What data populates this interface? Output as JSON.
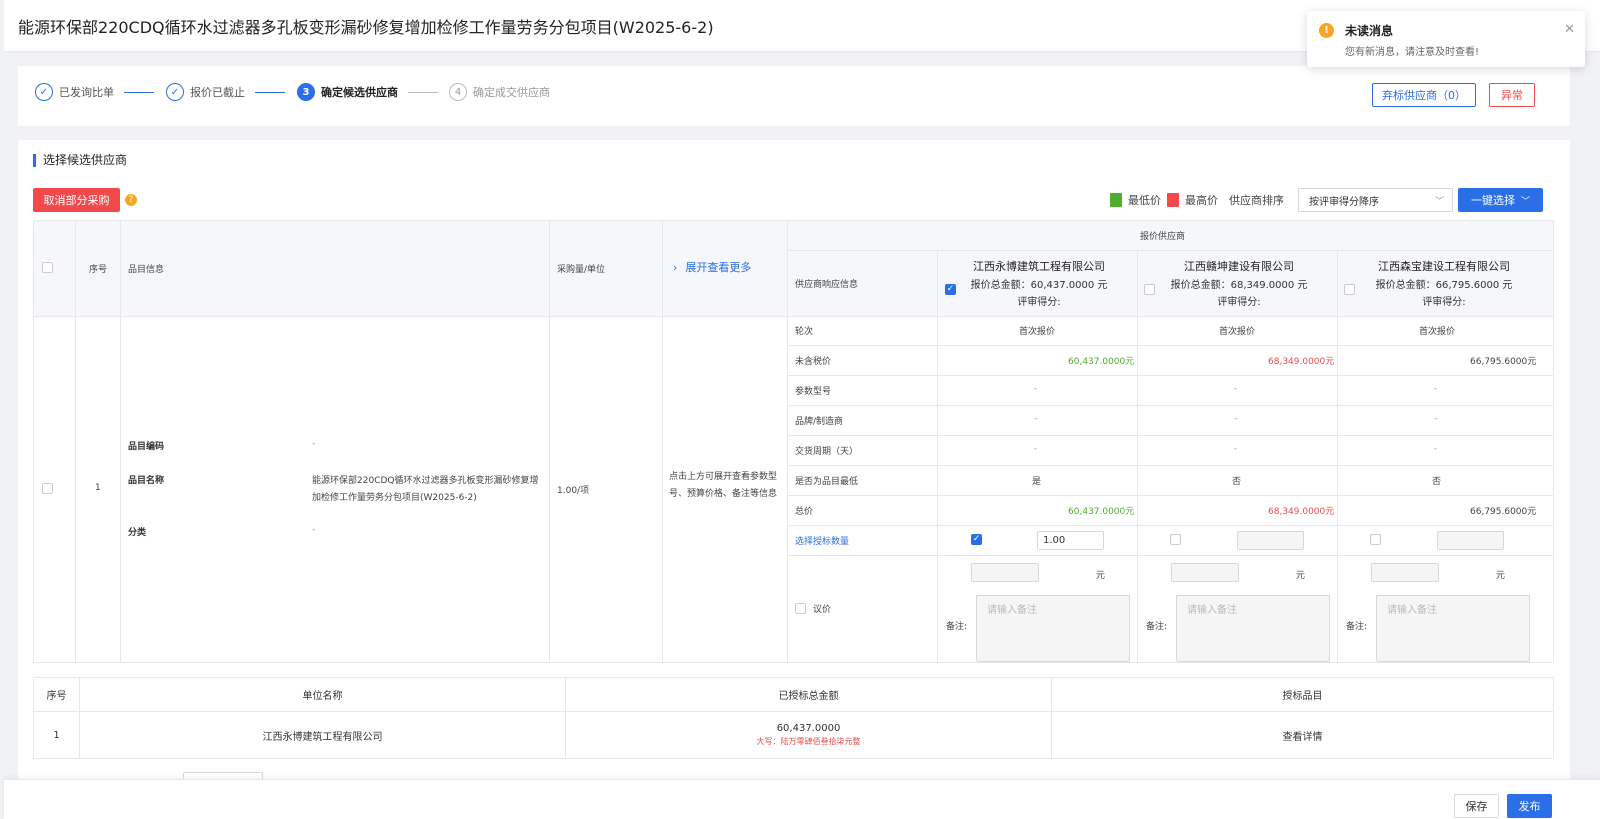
{
  "header": {
    "title": "能源环保部220CDQ循环水过滤器多孔板变形漏砂修复增加检修工作量劳务分包项目(W2025-6-2)"
  },
  "notification": {
    "title": "未读消息",
    "message": "您有新消息，请注意及时查看!",
    "icon": "warning-icon"
  },
  "steps": [
    {
      "num": "✓",
      "label": "已发询比单",
      "state": "done"
    },
    {
      "num": "✓",
      "label": "报价已截止",
      "state": "done"
    },
    {
      "num": "3",
      "label": "确定候选供应商",
      "state": "active"
    },
    {
      "num": "4",
      "label": "确定成交供应商",
      "state": "todo"
    }
  ],
  "actions": {
    "abandon": "弃标供应商（0）",
    "abnormal": "异常"
  },
  "section": {
    "title": "选择候选供应商",
    "cancel_btn": "取消部分采购",
    "legend_low": "最低价",
    "legend_high": "最高价",
    "sort_label": "供应商排序",
    "sort_value": "按评审得分降序",
    "one_click": "一键选择"
  },
  "colors": {
    "primary": "#2a6ee8",
    "low": "#4cae2e",
    "high": "#f24a4a"
  },
  "grid": {
    "headers": {
      "seq": "序号",
      "item_info": "品目信息",
      "qty_unit": "采购量/单位",
      "expand": "展开查看更多",
      "supplier_group": "报价供应商",
      "resp_info": "供应商响应信息"
    },
    "row": {
      "seq": "1",
      "code_label": "品目编码",
      "code_value": "-",
      "name_label": "品目名称",
      "name_value": "能源环保部220CDQ循环水过滤器多孔板变形漏砂修复增加检修工作量劳务分包项目(W2025-6-2)",
      "cat_label": "分类",
      "cat_value": "-",
      "qty": "1.00/项",
      "expand_hint": "点击上方可展开查看参数型号、预算价格、备注等信息"
    },
    "row_labels": [
      "轮次",
      "未含税价",
      "参数型号",
      "品牌/制造商",
      "交货周期（天）",
      "是否为品目最低",
      "总价",
      "选择授标数量",
      "议价"
    ],
    "remark_label": "备注:",
    "remark_placeholder": "请输入备注",
    "yuan": "元",
    "suppliers": [
      {
        "name": "江西永博建筑工程有限公司",
        "total": "报价总金额：60,437.0000 元",
        "score": "评审得分:",
        "checked": true,
        "round": "首次报价",
        "price": "60,437.0000元",
        "model": "-",
        "brand": "-",
        "delivery": "-",
        "lowest": "是",
        "sum": "60,437.0000元",
        "qty": "1.00"
      },
      {
        "name": "江西赣坤建设有限公司",
        "total": "报价总金额：68,349.0000 元",
        "score": "评审得分:",
        "checked": false,
        "round": "首次报价",
        "price": "68,349.0000元",
        "model": "-",
        "brand": "-",
        "delivery": "-",
        "lowest": "否",
        "sum": "68,349.0000元",
        "qty": ""
      },
      {
        "name": "江西森宝建设工程有限公司",
        "total": "报价总金额：66,795.6000 元",
        "score": "评审得分:",
        "checked": false,
        "round": "首次报价",
        "price": "66,795.6000元",
        "model": "-",
        "brand": "-",
        "delivery": "-",
        "lowest": "否",
        "sum": "66,795.6000元",
        "qty": ""
      }
    ]
  },
  "summary": {
    "headers": [
      "序号",
      "单位名称",
      "已授标总金额",
      "授标品目"
    ],
    "rows": [
      {
        "seq": "1",
        "name": "江西永博建筑工程有限公司",
        "amount": "60,437.0000",
        "amount_cn": "大写：陆万零肆佰叁拾柒元整",
        "detail": "查看详情"
      }
    ]
  },
  "footer": {
    "save": "保存",
    "publish": "发布"
  }
}
